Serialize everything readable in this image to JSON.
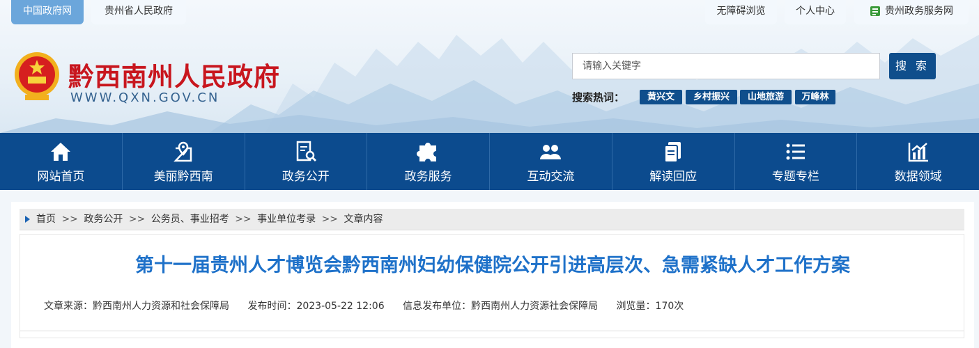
{
  "top_links": {
    "china_gov": "中国政府网",
    "guizhou_gov": "贵州省人民政府",
    "accessibility": "无障碍浏览",
    "personal_center": "个人中心",
    "service_net": "贵州政务服务网"
  },
  "site": {
    "name": "黔西南州人民政府",
    "url": "WWW.QXN.GOV.CN"
  },
  "search": {
    "placeholder": "请输入关键字",
    "button": "搜 索",
    "hot_label": "搜索热词：",
    "hot_terms": [
      "黄兴文",
      "乡村振兴",
      "山地旅游",
      "万峰林"
    ]
  },
  "nav": [
    {
      "label": "网站首页",
      "icon": "home-icon"
    },
    {
      "label": "美丽黔西南",
      "icon": "map-pin-icon"
    },
    {
      "label": "政务公开",
      "icon": "document-search-icon"
    },
    {
      "label": "政务服务",
      "icon": "puzzle-icon"
    },
    {
      "label": "互动交流",
      "icon": "people-icon"
    },
    {
      "label": "解读回应",
      "icon": "documents-icon"
    },
    {
      "label": "专题专栏",
      "icon": "list-icon"
    },
    {
      "label": "数据领域",
      "icon": "chart-icon"
    }
  ],
  "breadcrumb": [
    "首页",
    "政务公开",
    "公务员、事业招考",
    "事业单位考录",
    "文章内容"
  ],
  "breadcrumb_sep": ">>",
  "article": {
    "title": "第十一届贵州人才博览会黔西南州妇幼保健院公开引进高层次、急需紧缺人才工作方案",
    "source": "文章来源：黔西南州人力资源和社会保障局",
    "published": "发布时间：2023-05-22 12:06",
    "publisher": "信息发布单位：黔西南州人力资源社会保障局",
    "views": "浏览量：170次"
  },
  "colors": {
    "brand_blue": "#0c4b8e",
    "title_blue": "#1e71c9",
    "site_red": "#c8161e"
  }
}
